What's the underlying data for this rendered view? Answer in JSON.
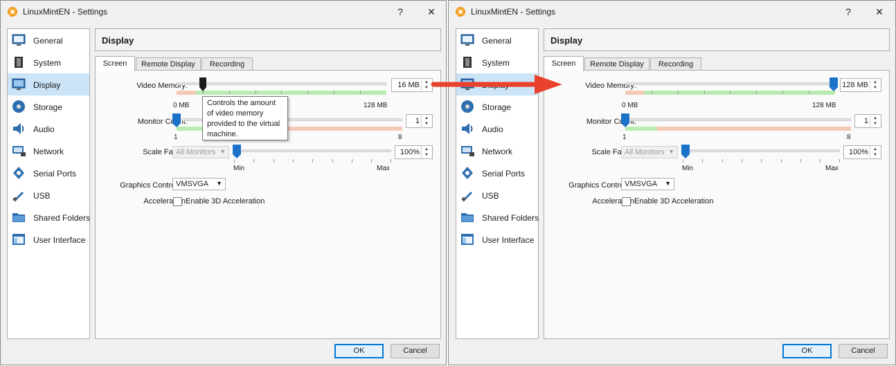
{
  "windows": [
    {
      "id": "left",
      "title": "LinuxMintEN - Settings",
      "help_label": "?",
      "close_label": "✕",
      "sidebar": [
        {
          "label": "General",
          "icon": "general-icon"
        },
        {
          "label": "System",
          "icon": "system-icon"
        },
        {
          "label": "Display",
          "icon": "display-icon",
          "selected": true
        },
        {
          "label": "Storage",
          "icon": "storage-icon"
        },
        {
          "label": "Audio",
          "icon": "audio-icon"
        },
        {
          "label": "Network",
          "icon": "network-icon"
        },
        {
          "label": "Serial Ports",
          "icon": "serial-ports-icon"
        },
        {
          "label": "USB",
          "icon": "usb-icon"
        },
        {
          "label": "Shared Folders",
          "icon": "shared-folders-icon"
        },
        {
          "label": "User Interface",
          "icon": "user-interface-icon"
        }
      ],
      "section_title": "Display",
      "tabs": [
        "Screen",
        "Remote Display",
        "Recording"
      ],
      "active_tab": "Screen",
      "video_memory": {
        "label": "Video Memory:",
        "value": "16 MB",
        "min_label": "0 MB",
        "max_label": "128 MB",
        "level_fraction": 0.125
      },
      "monitor_count": {
        "label": "Monitor Count:",
        "value": "1",
        "min_label": "1",
        "max_label": "8",
        "level_fraction": 0
      },
      "scale_factor": {
        "label": "Scale Factor:",
        "combo": "All Monitors",
        "value": "100%",
        "min_label": "Min",
        "max_label": "Max",
        "level_fraction": 0
      },
      "graphics_controller": {
        "label": "Graphics Controller:",
        "value": "VMSVGA"
      },
      "acceleration": {
        "label": "Acceleration:",
        "checkbox_label": "Enable 3D Acceleration",
        "checked": false
      },
      "tooltip": "Controls the amount of video memory provided to the virtual machine.",
      "ok_label": "OK",
      "cancel_label": "Cancel"
    },
    {
      "id": "right",
      "title": "LinuxMintEN - Settings",
      "help_label": "?",
      "close_label": "✕",
      "sidebar": [
        {
          "label": "General",
          "icon": "general-icon"
        },
        {
          "label": "System",
          "icon": "system-icon"
        },
        {
          "label": "Display",
          "icon": "display-icon",
          "selected": true
        },
        {
          "label": "Storage",
          "icon": "storage-icon"
        },
        {
          "label": "Audio",
          "icon": "audio-icon"
        },
        {
          "label": "Network",
          "icon": "network-icon"
        },
        {
          "label": "Serial Ports",
          "icon": "serial-ports-icon"
        },
        {
          "label": "USB",
          "icon": "usb-icon"
        },
        {
          "label": "Shared Folders",
          "icon": "shared-folders-icon"
        },
        {
          "label": "User Interface",
          "icon": "user-interface-icon"
        }
      ],
      "section_title": "Display",
      "tabs": [
        "Screen",
        "Remote Display",
        "Recording"
      ],
      "active_tab": "Screen",
      "video_memory": {
        "label": "Video Memory:",
        "value": "128 MB",
        "min_label": "0 MB",
        "max_label": "128 MB",
        "level_fraction": 1
      },
      "monitor_count": {
        "label": "Monitor Count:",
        "value": "1",
        "min_label": "1",
        "max_label": "8",
        "level_fraction": 0
      },
      "scale_factor": {
        "label": "Scale Factor:",
        "combo": "All Monitors",
        "value": "100%",
        "min_label": "Min",
        "max_label": "Max",
        "level_fraction": 0
      },
      "graphics_controller": {
        "label": "Graphics Controller:",
        "value": "VMSVGA"
      },
      "acceleration": {
        "label": "Acceleration:",
        "checkbox_label": "Enable 3D Acceleration",
        "checked": false
      },
      "ok_label": "OK",
      "cancel_label": "Cancel"
    }
  ],
  "colors": {
    "selection": "#cce4f7",
    "accent_blue": "#0078d7",
    "bar_green": "#b8ecb0",
    "bar_red": "#f6c8b6",
    "annotation_arrow": "#e8412c"
  }
}
